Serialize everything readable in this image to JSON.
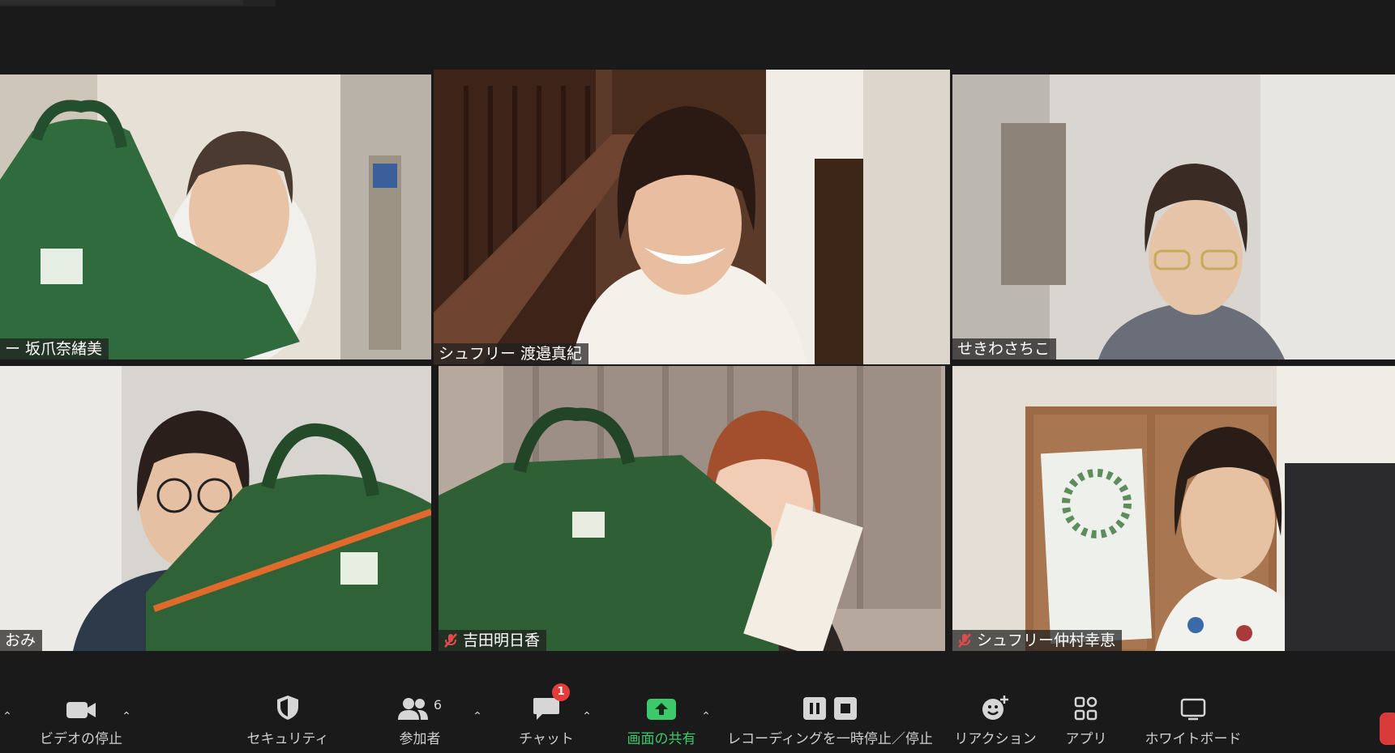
{
  "participants": [
    {
      "name": "ー 坂爪奈緒美",
      "muted": false,
      "active": false
    },
    {
      "name": "シュフリー 渡邉真紀",
      "muted": false,
      "active": true
    },
    {
      "name": "せきわさちこ",
      "muted": false,
      "active": false
    },
    {
      "name": "おみ",
      "muted": false,
      "active": false
    },
    {
      "name": "吉田明日香",
      "muted": true,
      "active": false
    },
    {
      "name": "シュフリー仲村幸恵",
      "muted": true,
      "active": false
    }
  ],
  "toolbar": {
    "video_label": "ビデオの停止",
    "security_label": "セキュリティ",
    "participants_label": "参加者",
    "participants_count": "6",
    "chat_label": "チャット",
    "chat_badge": "1",
    "share_label": "画面の共有",
    "recording_label": "レコーディングを一時停止／停止",
    "reactions_label": "リアクション",
    "apps_label": "アプリ",
    "whiteboard_label": "ホワイトボード"
  },
  "colors": {
    "active_border": "#d4e96b",
    "share_green": "#3cc96b",
    "badge_red": "#e43b3b"
  }
}
